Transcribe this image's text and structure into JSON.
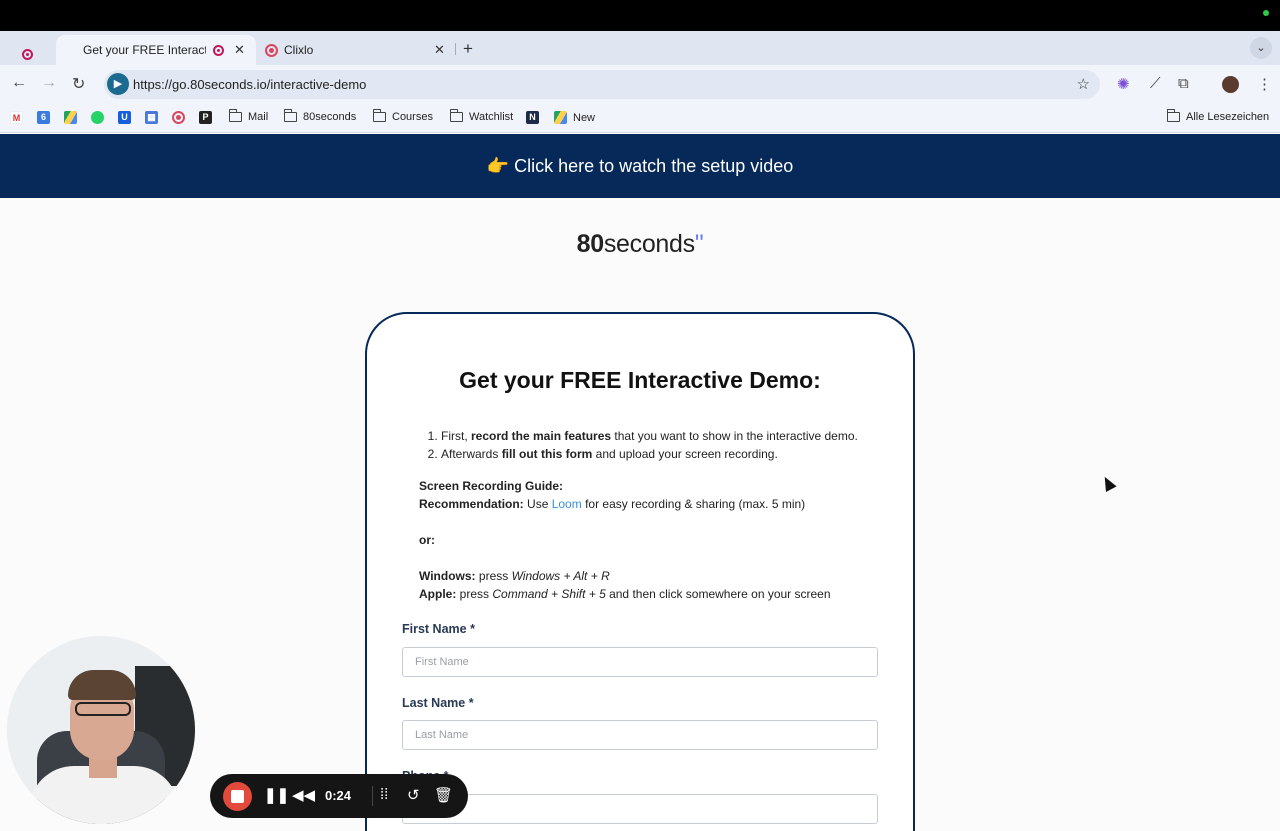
{
  "browser": {
    "tabs": [
      {
        "title": "Get your FREE Interactive Demo",
        "active": true
      },
      {
        "title": "Clixlo",
        "active": false
      }
    ],
    "close_glyph": "✕",
    "new_tab_glyph": "+",
    "url": "https://go.80seconds.io/interactive-demo",
    "bookmarks": [
      {
        "label": "",
        "icon": "gmail-icon"
      },
      {
        "label": "",
        "icon": "calendar-icon"
      },
      {
        "label": "",
        "icon": "drive-icon"
      },
      {
        "label": "",
        "icon": "whatsapp-icon"
      },
      {
        "label": "",
        "icon": "bitwarden-icon"
      },
      {
        "label": "",
        "icon": "app-icon"
      },
      {
        "label": "",
        "icon": "clixlo-icon"
      },
      {
        "label": "",
        "icon": "p-icon"
      },
      {
        "label": "Mail",
        "icon": "folder-icon"
      },
      {
        "label": "80seconds",
        "icon": "folder-icon"
      },
      {
        "label": "Courses",
        "icon": "folder-icon"
      },
      {
        "label": "Watchlist",
        "icon": "folder-icon"
      },
      {
        "label": "",
        "icon": "n-icon"
      },
      {
        "label": "New",
        "icon": "drive-icon"
      }
    ],
    "all_bookmarks": "Alle Lesezeichen"
  },
  "page": {
    "banner": "👉 Click here to watch the setup video",
    "logo": {
      "bold": "80",
      "rest": "seconds",
      "mark": "\""
    },
    "card": {
      "title": "Get your FREE Interactive Demo:",
      "steps": [
        {
          "pre": "First, ",
          "bold": "record the main features",
          "post": " that you want to show in the interactive demo."
        },
        {
          "pre": "Afterwards ",
          "bold": "fill out this form",
          "post": " and upload your screen recording."
        }
      ],
      "guide_title": "Screen Recording Guide:",
      "recommendation_label": "Recommendation:",
      "recommendation_pre": " Use ",
      "recommendation_link": "Loom",
      "recommendation_post": " for easy recording & sharing (max. 5 min)",
      "or": "or:",
      "windows_label": "Windows:",
      "windows_pre": " press ",
      "windows_keys": "Windows + Alt + R",
      "apple_label": "Apple:",
      "apple_pre": " press ",
      "apple_keys": "Command + Shift + 5",
      "apple_post": " and then click somewhere on your screen",
      "fields": [
        {
          "label": "First Name *",
          "placeholder": "First Name"
        },
        {
          "label": "Last Name *",
          "placeholder": "Last Name"
        },
        {
          "label": "Phone *",
          "placeholder": ""
        }
      ]
    }
  },
  "recorder": {
    "timer": "0:24",
    "accent": "#e24a3b"
  }
}
